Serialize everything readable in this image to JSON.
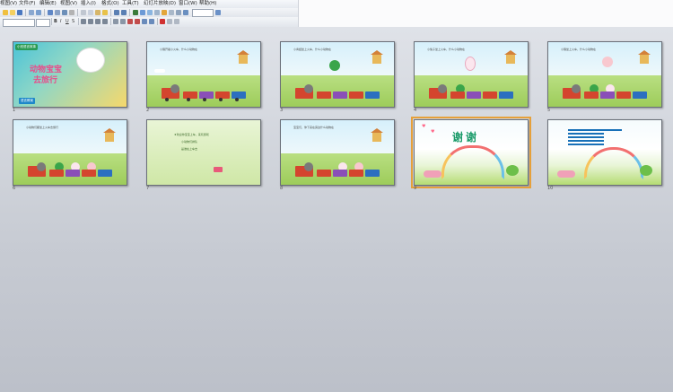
{
  "menu": [
    "视图(V)",
    "文件(F)",
    "编辑(E)",
    "视图(V)",
    "插入(I)",
    "格式(O)",
    "工具(T)",
    "幻灯片放映(D)",
    "窗口(W)",
    "帮助(H)"
  ],
  "toolbar": {
    "font_name_placeholder": "",
    "font_size_placeholder": ""
  },
  "slides": [
    {
      "num": "1",
      "title_line1": "动物宝宝",
      "title_line2": "去旅行",
      "badge": "小班语言故事",
      "footer": "语言教案"
    },
    {
      "num": "2",
      "text": "小猪开着小火车，什么小动物在"
    },
    {
      "num": "3",
      "text": "小青蛙坐上火车，什么小动物在"
    },
    {
      "num": "4",
      "text": "小兔子坐上火车，什么小动物在"
    },
    {
      "num": "5",
      "text": "小猪坐上火车，什么小动物在"
    },
    {
      "num": "6",
      "text": "小动物们都坐上火车去旅行"
    },
    {
      "num": "7",
      "lines": [
        "★欢迎你宝宝上车，来玩游戏",
        "小动物们排队",
        "是谁在上车去"
      ]
    },
    {
      "num": "8",
      "text": "宝宝们，你下来在旁边什么动物在"
    },
    {
      "num": "9",
      "thanks": "谢谢"
    },
    {
      "num": "10",
      "lines": [
        "",
        "",
        "",
        "",
        ""
      ]
    }
  ],
  "colors": {
    "selected_outline": "#e6a03a",
    "title_pink": "#e84d8b",
    "thanks_green": "#1b9b6a"
  }
}
